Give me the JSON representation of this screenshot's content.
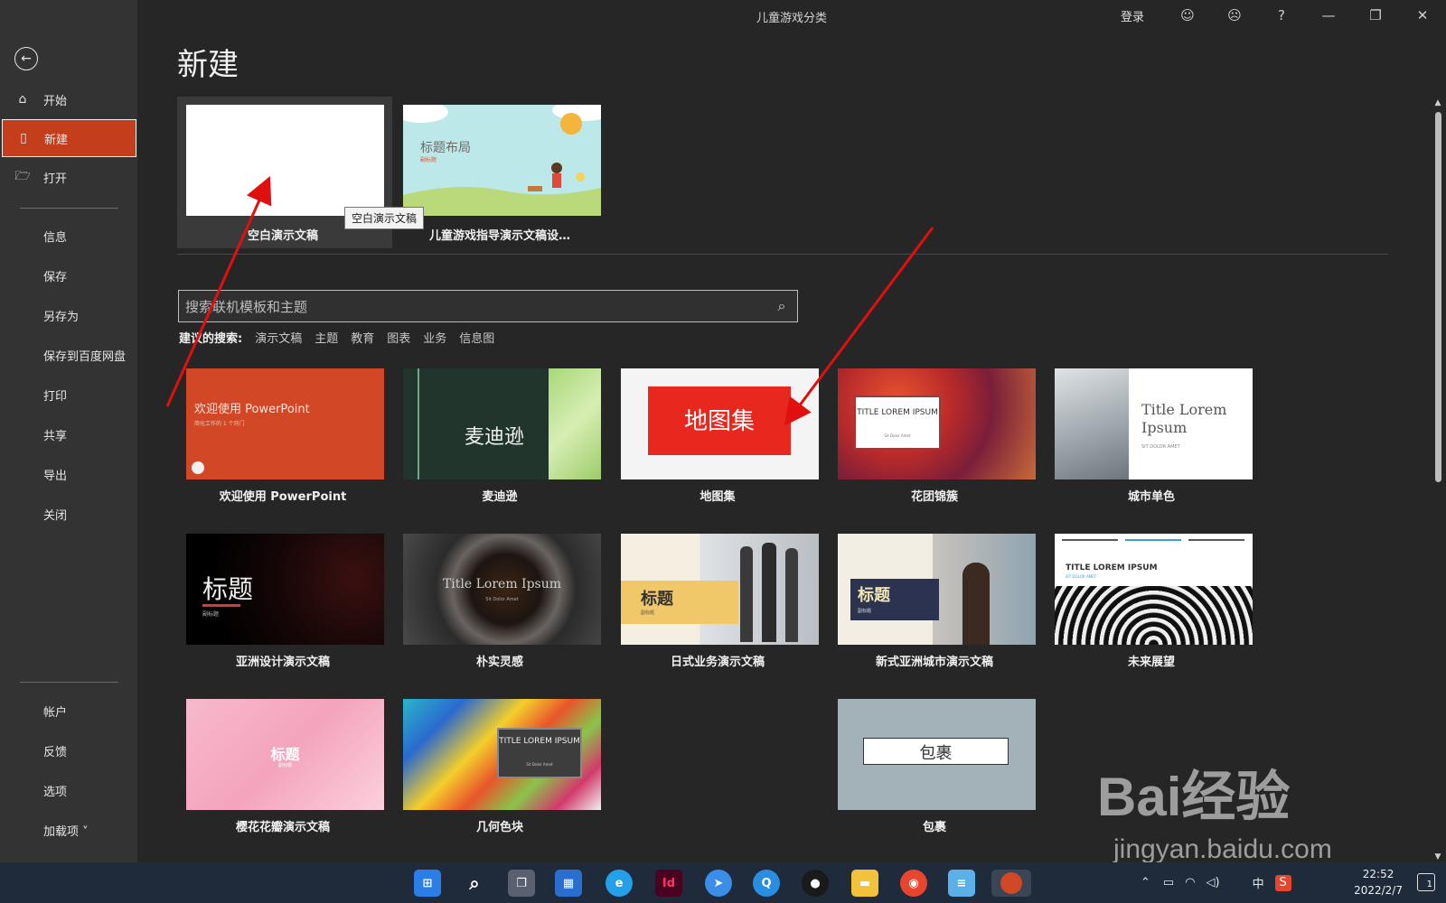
{
  "window": {
    "title": "儿童游戏分类",
    "signin": "登录",
    "smile_icon": "smile-icon",
    "frown_icon": "frown-icon",
    "help": "?",
    "minimize": "—",
    "restore": "❐",
    "close": "✕"
  },
  "sidebar": {
    "items": [
      {
        "label": "开始",
        "icon": "home-icon"
      },
      {
        "label": "新建",
        "icon": "new-doc-icon"
      },
      {
        "label": "打开",
        "icon": "open-folder-icon"
      }
    ],
    "sub_items": [
      "信息",
      "保存",
      "另存为",
      "保存到百度网盘",
      "打印",
      "共享",
      "导出",
      "关闭"
    ],
    "bottom_items": [
      "帐户",
      "反馈",
      "选项",
      "加载项 ˅"
    ]
  },
  "main": {
    "title": "新建",
    "featured": [
      {
        "caption": "空白演示文稿"
      },
      {
        "caption": "儿童游戏指导演示文稿设…",
        "thumb_title": "标题布局",
        "thumb_sub": "副标题"
      }
    ],
    "tooltip": "空白演示文稿",
    "search_placeholder": "搜索联机模板和主题",
    "suggest_lead": "建议的搜索:",
    "suggestions": [
      "演示文稿",
      "主题",
      "教育",
      "图表",
      "业务",
      "信息图"
    ],
    "templates": [
      {
        "caption": "欢迎使用 PowerPoint",
        "thumb_text": "欢迎使用 PowerPoint",
        "thumb_sub": "简化工作的 1 个窍门"
      },
      {
        "caption": "麦迪逊",
        "thumb_text": "麦迪逊"
      },
      {
        "caption": "地图集",
        "thumb_text": "地图集"
      },
      {
        "caption": "花团锦簇",
        "thumb_text": "TITLE LOREM IPSUM",
        "thumb_sub": "Sit Dolor Amet"
      },
      {
        "caption": "城市单色",
        "thumb_text": "Title Lorem Ipsum",
        "thumb_sub": "SIT DOLOR AMET"
      },
      {
        "caption": "亚洲设计演示文稿",
        "thumb_text": "标题",
        "thumb_sub": "副标题"
      },
      {
        "caption": "朴实灵感",
        "thumb_text": "Title Lorem Ipsum",
        "thumb_sub": "Sit Dolor Amet"
      },
      {
        "caption": "日式业务演示文稿",
        "thumb_text": "标题",
        "thumb_sub": "副标题"
      },
      {
        "caption": "新式亚洲城市演示文稿",
        "thumb_text": "标题",
        "thumb_sub": "副标题"
      },
      {
        "caption": "未来展望",
        "thumb_text": "TITLE LOREM IPSUM",
        "thumb_sub": "SIT DOLOR AMET"
      },
      {
        "caption": "樱花花瓣演示文稿",
        "thumb_text": "标题",
        "thumb_sub": "副标题"
      },
      {
        "caption": "几何色块",
        "thumb_text": "TITLE LOREM IPSUM",
        "thumb_sub": "Sit Dolor Amet"
      },
      {
        "caption": "包裹",
        "thumb_text": "包裹"
      }
    ]
  },
  "taskbar": {
    "apps": [
      "start-icon",
      "search-icon",
      "task-view-icon",
      "widgets-icon",
      "edge-icon",
      "indesign-icon",
      "feishu-icon",
      "qq-browser-icon",
      "qq-icon",
      "file-explorer-icon",
      "chrome-icon",
      "notepad-icon",
      "powerpoint-icon"
    ],
    "indesign_label": "Id",
    "ime": "中",
    "sogou": "S",
    "time": "22:52",
    "date": "2022/2/7",
    "notif_count": "1"
  },
  "watermark": {
    "brand": "Bai经验",
    "url": "jingyan.baidu.com"
  },
  "colors": {
    "accent": "#c43e1c",
    "background": "#262626",
    "sidebar": "#333333"
  }
}
